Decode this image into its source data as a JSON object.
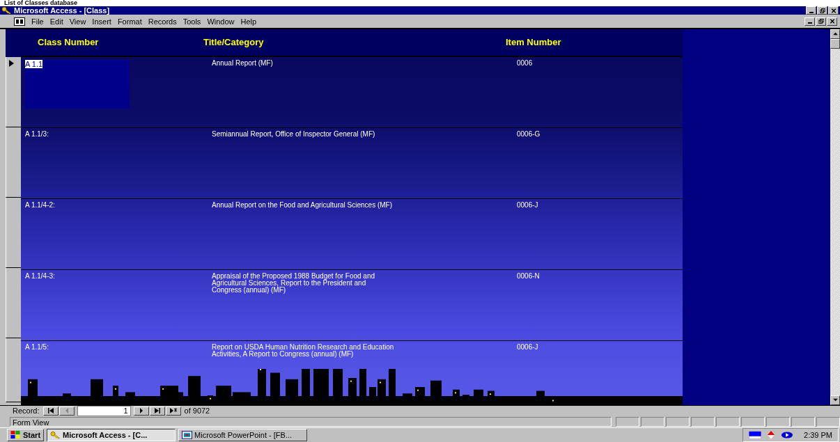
{
  "slide_title": "List of Classes database",
  "window": {
    "title": "Microsoft Access - [Class]"
  },
  "menu": [
    "File",
    "Edit",
    "View",
    "Insert",
    "Format",
    "Records",
    "Tools",
    "Window",
    "Help"
  ],
  "columns": [
    "Class Number",
    "Title/Category",
    "Item Number"
  ],
  "records": [
    {
      "class_number": "A 1.1",
      "title": "Annual Report  (MF)",
      "item_number": "0006",
      "current": true
    },
    {
      "class_number": "A 1.1/3:",
      "title": "Semiannual Report, Office of Inspector General (MF)",
      "item_number": "0006-G",
      "current": false
    },
    {
      "class_number": "A 1.1/4-2:",
      "title": "Annual Report on the Food and Agricultural Sciences  (MF)",
      "item_number": "0006-J",
      "current": false
    },
    {
      "class_number": "A 1.1/4-3:",
      "title": "Appraisal of the Proposed 1988 Budget for Food and Agricultural Sciences, Report to the President and Congress (annual)  (MF)",
      "item_number": "0006-N",
      "current": false
    },
    {
      "class_number": "A 1.1/5:",
      "title": "Report on USDA Human Nutrition Research and Education Activities, A Report to Congress (annual)  (MF)",
      "item_number": "0006-J",
      "current": false
    }
  ],
  "navigator": {
    "label": "Record:",
    "current": "1",
    "total": "of  9072"
  },
  "status_bar": "Form View",
  "taskbar": {
    "start": "Start",
    "tasks": [
      {
        "label": "Microsoft Access - [C...",
        "selected": true
      },
      {
        "label": "Microsoft PowerPoint - [FB...",
        "selected": false
      }
    ],
    "clock": "2:39 PM"
  }
}
